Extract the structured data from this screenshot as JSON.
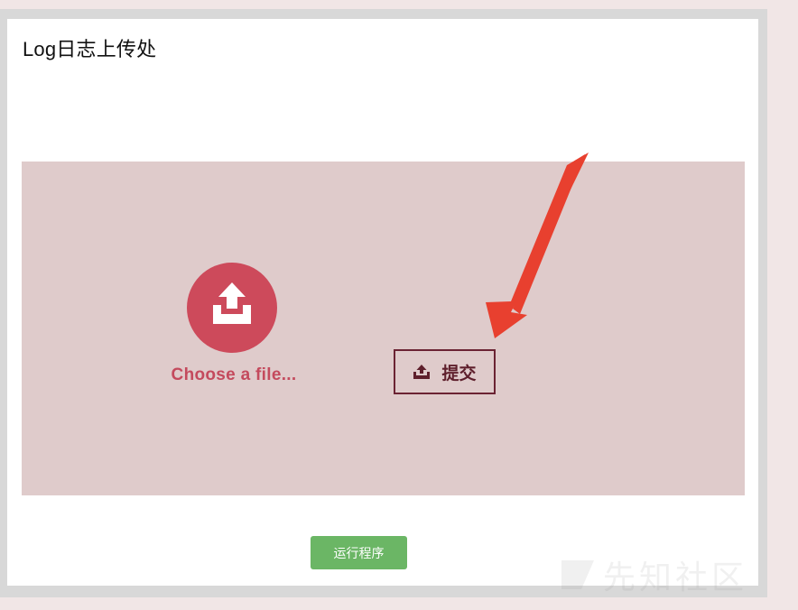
{
  "page": {
    "title": "Log日志上传处"
  },
  "upload": {
    "choose_label": "Choose a file...",
    "submit_label": "提交"
  },
  "actions": {
    "run_label": "运行程序"
  },
  "watermark": {
    "text": "先知社区"
  },
  "icons": {
    "upload": "upload-tray-icon",
    "submit": "upload-icon",
    "annotation": "red-arrow"
  },
  "colors": {
    "dropzone_bg": "#dfcbcb",
    "upload_circle": "#cd4a5b",
    "choose_text": "#c44a5d",
    "submit_border": "#6b2333",
    "run_button": "#6bb665",
    "annotation_arrow": "#e8402f"
  }
}
